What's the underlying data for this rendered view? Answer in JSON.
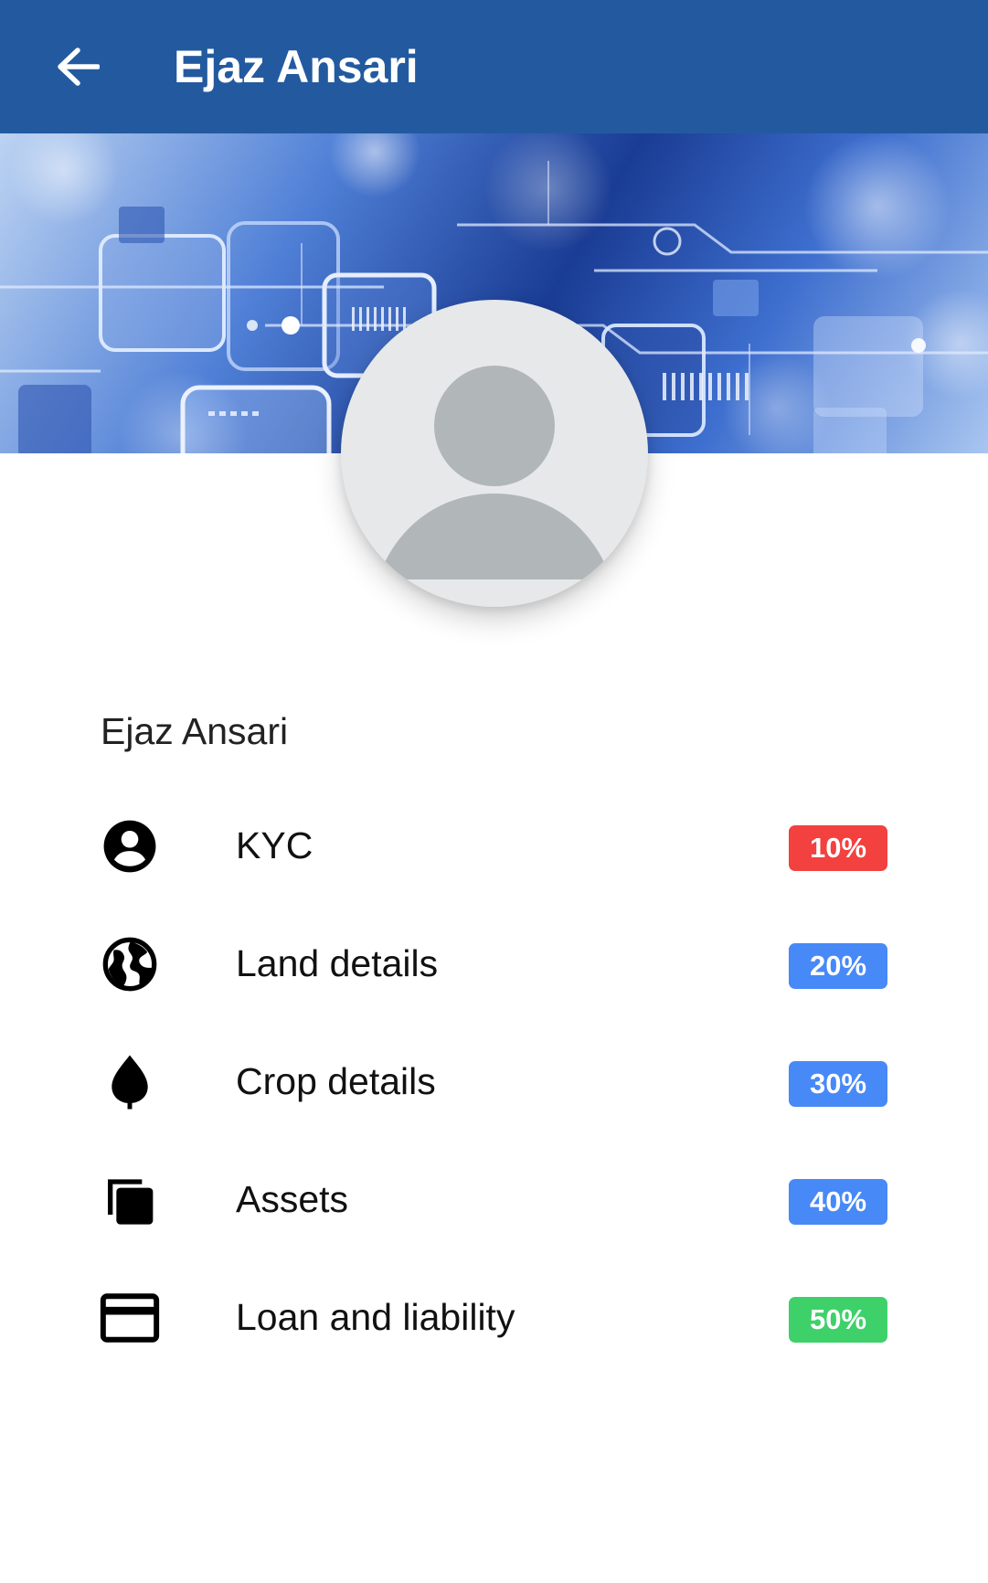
{
  "appbar": {
    "title": "Ejaz Ansari",
    "back_icon": "arrow-back-icon",
    "background": "#235a9f"
  },
  "profile": {
    "name": "Ejaz Ansari",
    "avatar_icon": "default-avatar-icon"
  },
  "menu": [
    {
      "icon": "account-circle-icon",
      "label": "KYC",
      "badge": "10%",
      "progress": 10,
      "badge_color": "#f2413f"
    },
    {
      "icon": "globe-icon",
      "label": "Land details",
      "badge": "20%",
      "progress": 20,
      "badge_color": "#4789f7"
    },
    {
      "icon": "leaf-icon",
      "label": "Crop details",
      "badge": "30%",
      "progress": 30,
      "badge_color": "#4789f7"
    },
    {
      "icon": "copy-stack-icon",
      "label": "Assets",
      "badge": "40%",
      "progress": 40,
      "badge_color": "#4789f7"
    },
    {
      "icon": "credit-card-icon",
      "label": "Loan and liability",
      "badge": "50%",
      "progress": 50,
      "badge_color": "#3ed16a"
    }
  ]
}
